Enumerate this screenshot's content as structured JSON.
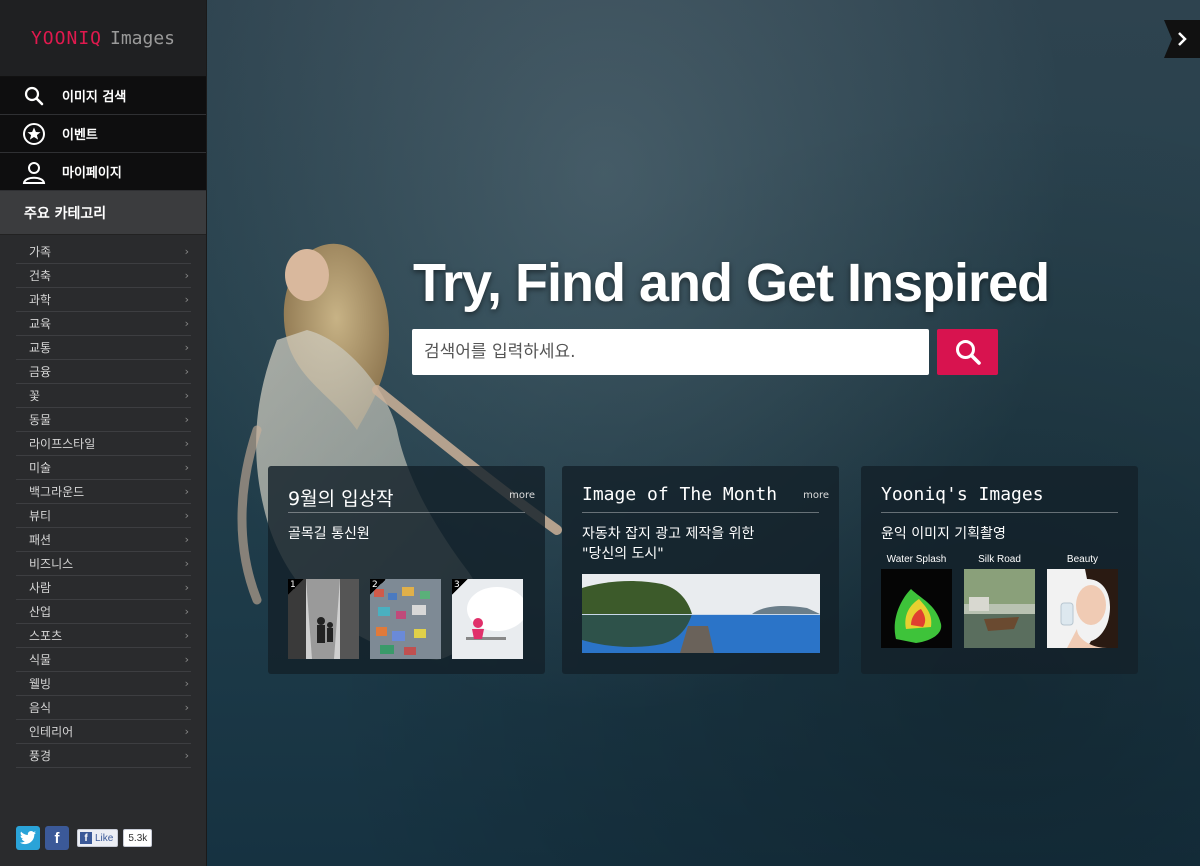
{
  "logo": {
    "brand": "YOONIQ",
    "product": "Images"
  },
  "nav": [
    {
      "label": "이미지 검색",
      "icon": "search-icon"
    },
    {
      "label": "이벤트",
      "icon": "star-icon"
    },
    {
      "label": "마이페이지",
      "icon": "user-icon"
    }
  ],
  "categories": {
    "header": "주요 카테고리",
    "items": [
      "가족",
      "건축",
      "과학",
      "교육",
      "교통",
      "금융",
      "꽃",
      "동물",
      "라이프스타일",
      "미술",
      "백그라운드",
      "뷰티",
      "패션",
      "비즈니스",
      "사람",
      "산업",
      "스포츠",
      "식물",
      "웰빙",
      "음식",
      "인테리어",
      "풍경"
    ]
  },
  "social": {
    "like_label": "Like",
    "like_count": "5.3k"
  },
  "hero": {
    "title": "Try, Find and Get Inspired",
    "search_placeholder": "검색어를 입력하세요."
  },
  "cards": {
    "contest": {
      "title": "9월의 입상작",
      "more": "more",
      "subtitle": "골목길 통신원",
      "thumbs": [
        "1",
        "2",
        "3"
      ]
    },
    "month": {
      "title": "Image of The Month",
      "more": "more",
      "subtitle_line1": "자동차 잡지 광고 제작을 위한",
      "subtitle_line2": "\"당신의 도시\""
    },
    "yooniq": {
      "title": "Yooniq's Images",
      "subtitle": "윤익 이미지 기획촬영",
      "items": [
        "Water Splash",
        "Silk Road",
        "Beauty"
      ]
    }
  },
  "colors": {
    "accent": "#d8134f",
    "sidebar": "#2a2b2d",
    "nav": "#0e0e0f"
  }
}
